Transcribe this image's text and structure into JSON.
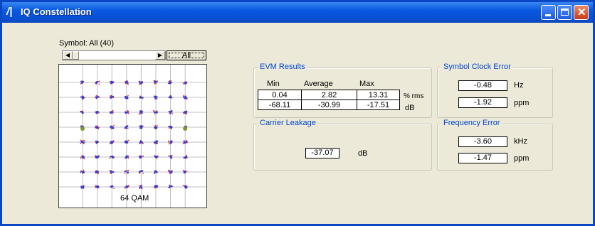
{
  "window": {
    "title": "IQ Constellation",
    "icon": "app-logo-icon"
  },
  "symbol": {
    "label": "Symbol: All (40)",
    "all_button": "All"
  },
  "constellation": {
    "label": "64 QAM",
    "point_color": "#3b3bd0",
    "noise_color": "#e03030",
    "pilot_color": "#7a9a30"
  },
  "evm": {
    "title": "EVM Results",
    "headers": [
      "Min",
      "Average",
      "Max"
    ],
    "rows": [
      {
        "values": [
          "0.04",
          "2.82",
          "13.31"
        ],
        "unit": "% rms"
      },
      {
        "values": [
          "-68.11",
          "-30.99",
          "-17.51"
        ],
        "unit": "dB"
      }
    ]
  },
  "carrier_leakage": {
    "title": "Carrier Leakage",
    "value": "-37.07",
    "unit": "dB"
  },
  "symbol_clock_error": {
    "title": "Symbol Clock Error",
    "hz_value": "-0.48",
    "hz_unit": "Hz",
    "ppm_value": "-1.92",
    "ppm_unit": "ppm"
  },
  "frequency_error": {
    "title": "Frequency Error",
    "khz_value": "-3.60",
    "khz_unit": "kHz",
    "ppm_value": "-1.47",
    "ppm_unit": "ppm"
  }
}
